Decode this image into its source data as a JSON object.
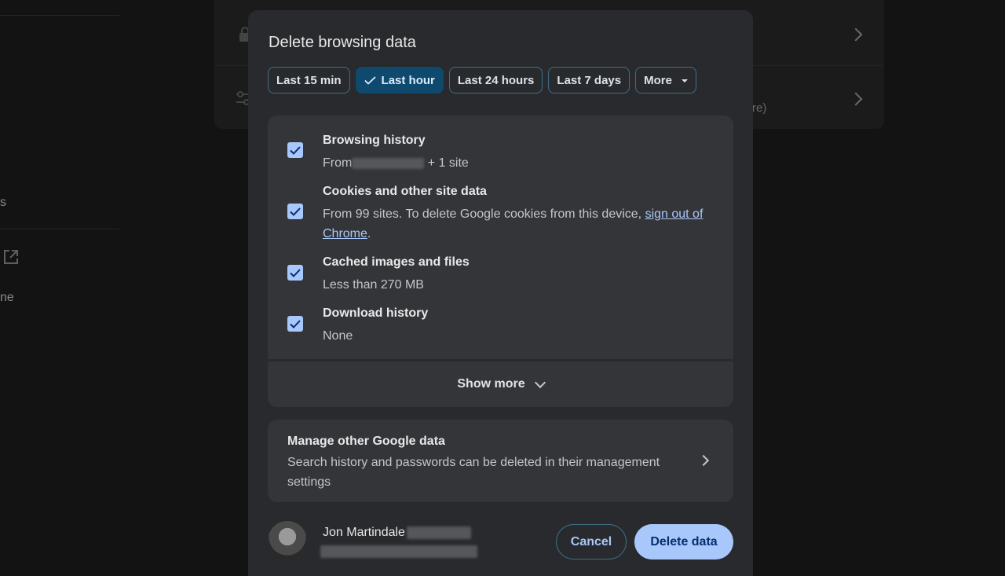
{
  "background": {
    "left_partial_1": "s",
    "left_partial_2": "ne",
    "right_partial": "re)"
  },
  "dialog": {
    "title": "Delete browsing data",
    "time_ranges": [
      {
        "label": "Last 15 min",
        "selected": false
      },
      {
        "label": "Last hour",
        "selected": true
      },
      {
        "label": "Last 24 hours",
        "selected": false
      },
      {
        "label": "Last 7 days",
        "selected": false
      },
      {
        "label": "More",
        "selected": false
      }
    ],
    "items": [
      {
        "title": "Browsing history",
        "sub_prefix": "From",
        "sub_suffix": "+ 1 site",
        "checked": true
      },
      {
        "title": "Cookies and other site data",
        "sub": "From 99 sites. To delete Google cookies from this device, ",
        "link": "sign out of Chrome",
        "sub_end": ".",
        "checked": true
      },
      {
        "title": "Cached images and files",
        "sub": "Less than 270 MB",
        "checked": true
      },
      {
        "title": "Download history",
        "sub": "None",
        "checked": true
      }
    ],
    "show_more_label": "Show more",
    "manage": {
      "title": "Manage other Google data",
      "subtitle": "Search history and passwords can be deleted in their management settings"
    },
    "account": {
      "name": "Jon Martindale"
    },
    "cancel_label": "Cancel",
    "delete_label": "Delete data"
  },
  "colors": {
    "accent": "#a8c7fa",
    "selected_chip": "#0f4a6e",
    "dialog_bg": "#292a2d"
  }
}
